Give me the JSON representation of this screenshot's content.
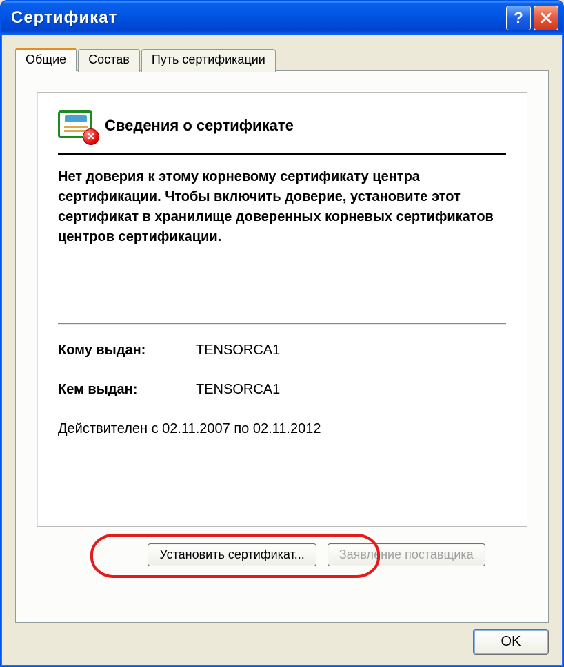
{
  "window": {
    "title": "Сертификат"
  },
  "tabs": {
    "general": "Общие",
    "composition": "Состав",
    "cert_path": "Путь сертификации"
  },
  "card": {
    "heading": "Сведения о сертификате",
    "description": "Нет доверия к этому корневому сертификату центра сертификации. Чтобы включить доверие, установите этот сертификат в хранилище доверенных корневых сертификатов центров сертификации.",
    "issued_to_label": "Кому выдан:",
    "issued_to_value": "TENSORCA1",
    "issued_by_label": "Кем выдан:",
    "issued_by_value": "TENSORCA1",
    "validity": "Действителен с  02.11.2007  по  02.11.2012"
  },
  "buttons": {
    "install": "Установить сертификат...",
    "issuer_statement": "Заявление поставщика",
    "ok": "OK"
  }
}
